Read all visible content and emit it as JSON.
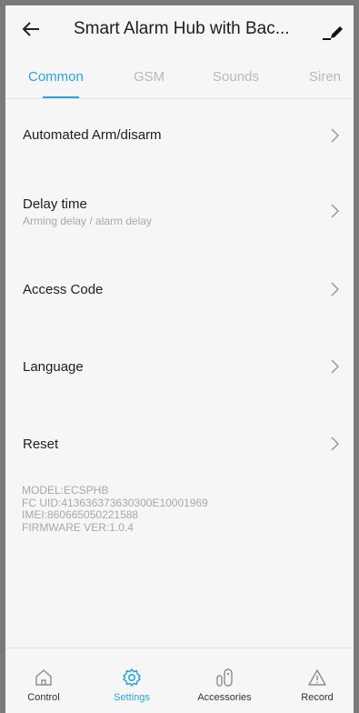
{
  "header": {
    "title": "Smart Alarm Hub with Bac..."
  },
  "tabs": [
    {
      "label": "Common",
      "active": true
    },
    {
      "label": "GSM",
      "active": false
    },
    {
      "label": "Sounds",
      "active": false
    },
    {
      "label": "Siren",
      "active": false
    }
  ],
  "settings": [
    {
      "label": "Automated Arm/disarm",
      "sublabel": ""
    },
    {
      "label": "Delay time",
      "sublabel": "Arming delay / alarm delay"
    },
    {
      "label": "Access Code",
      "sublabel": ""
    },
    {
      "label": "Language",
      "sublabel": ""
    },
    {
      "label": "Reset",
      "sublabel": ""
    }
  ],
  "device_info": {
    "model": "MODEL:ECSPHB",
    "fc_uid": "FC UID:413636373630300E10001969",
    "imei": "IMEI:860665050221588",
    "firmware": "FIRMWARE VER:1.0.4"
  },
  "bottom_nav": [
    {
      "label": "Control",
      "icon": "home-icon",
      "active": false
    },
    {
      "label": "Settings",
      "icon": "gear-icon",
      "active": true
    },
    {
      "label": "Accessories",
      "icon": "sensor-icon",
      "active": false
    },
    {
      "label": "Record",
      "icon": "warning-icon",
      "active": false
    }
  ],
  "colors": {
    "accent": "#2aa6dc",
    "background": "#f6f6f6",
    "text": "#1e1e1e",
    "muted": "#a8a8a8"
  }
}
